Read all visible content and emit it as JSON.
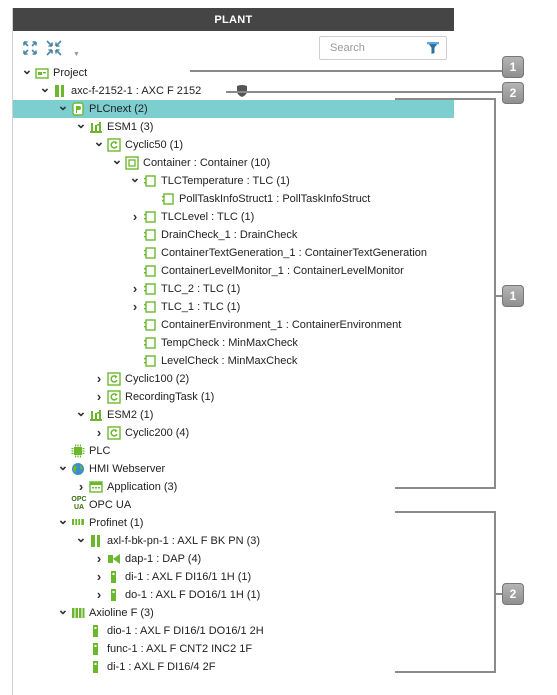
{
  "panel": {
    "title": "PLANT",
    "toolbar": {
      "expand_all_icon": "expand-all-icon",
      "collapse_all_icon": "collapse-all-icon",
      "search_placeholder": "Search",
      "filter_icon": "filter-icon"
    }
  },
  "tree": [
    {
      "id": "project",
      "label": "Project",
      "expander": "expanded",
      "icon": "project-icon"
    },
    {
      "id": "controller",
      "label": "axc-f-2152-1 : AXC F 2152",
      "expander": "expanded",
      "icon": "controller-icon",
      "shield_icon": "shield-icon"
    },
    {
      "id": "plcnext",
      "label": "PLCnext (2)",
      "expander": "expanded",
      "icon": "plcnext-icon",
      "selected": true
    },
    {
      "id": "esm1",
      "label": "ESM1 (3)",
      "expander": "expanded",
      "icon": "esm-icon"
    },
    {
      "id": "cyclic50",
      "label": "Cyclic50 (1)",
      "expander": "expanded",
      "icon": "task-icon"
    },
    {
      "id": "container",
      "label": "Container : Container (10)",
      "expander": "expanded",
      "icon": "container-icon"
    },
    {
      "id": "tlctemperature",
      "label": "TLCTemperature : TLC (1)",
      "expander": "expanded",
      "icon": "program-icon"
    },
    {
      "id": "polltask",
      "label": "PollTaskInfoStruct1 : PollTaskInfoStruct",
      "expander": "none",
      "icon": "program-icon"
    },
    {
      "id": "tlclevel",
      "label": "TLCLevel : TLC (1)",
      "expander": "collapsed",
      "icon": "program-icon"
    },
    {
      "id": "draincheck",
      "label": "DrainCheck_1 : DrainCheck",
      "expander": "none",
      "icon": "program-icon"
    },
    {
      "id": "containertextgeneration",
      "label": "ContainerTextGeneration_1 : ContainerTextGeneration",
      "expander": "none",
      "icon": "program-icon"
    },
    {
      "id": "containerlevelmonitor",
      "label": "ContainerLevelMonitor_1 : ContainerLevelMonitor",
      "expander": "none",
      "icon": "program-icon"
    },
    {
      "id": "tlc2",
      "label": "TLC_2 : TLC (1)",
      "expander": "collapsed",
      "icon": "program-icon"
    },
    {
      "id": "tlc1",
      "label": "TLC_1 : TLC (1)",
      "expander": "collapsed",
      "icon": "program-icon"
    },
    {
      "id": "containerenvironment",
      "label": "ContainerEnvironment_1 : ContainerEnvironment",
      "expander": "none",
      "icon": "program-icon"
    },
    {
      "id": "tempcheck",
      "label": "TempCheck : MinMaxCheck",
      "expander": "none",
      "icon": "program-icon"
    },
    {
      "id": "levelcheck",
      "label": "LevelCheck : MinMaxCheck",
      "expander": "none",
      "icon": "program-icon"
    },
    {
      "id": "cyclic100",
      "label": "Cyclic100 (2)",
      "expander": "collapsed",
      "icon": "task-icon"
    },
    {
      "id": "recordingtask",
      "label": "RecordingTask (1)",
      "expander": "collapsed",
      "icon": "task-icon"
    },
    {
      "id": "esm2",
      "label": "ESM2 (1)",
      "expander": "expanded",
      "icon": "esm-icon"
    },
    {
      "id": "cyclic200",
      "label": "Cyclic200 (4)",
      "expander": "collapsed",
      "icon": "task-icon"
    },
    {
      "id": "plc",
      "label": "PLC",
      "expander": "none",
      "icon": "plc-icon"
    },
    {
      "id": "hmiwebserver",
      "label": "HMI Webserver",
      "expander": "expanded",
      "icon": "globe-icon"
    },
    {
      "id": "application",
      "label": "Application (3)",
      "expander": "collapsed",
      "icon": "application-icon"
    },
    {
      "id": "opcua",
      "label": "OPC UA",
      "expander": "none",
      "icon": "opc-ua-icon",
      "icon_text": "OPC UA"
    },
    {
      "id": "profinet",
      "label": "Profinet (1)",
      "expander": "expanded",
      "icon": "profinet-icon"
    },
    {
      "id": "axlbkpn",
      "label": "axl-f-bk-pn-1 : AXL F BK PN (3)",
      "expander": "expanded",
      "icon": "bus-coupler-icon"
    },
    {
      "id": "dap1",
      "label": "dap-1 : DAP (4)",
      "expander": "collapsed",
      "icon": "dap-icon"
    },
    {
      "id": "di1",
      "label": "di-1 : AXL F DI16/1 1H (1)",
      "expander": "collapsed",
      "icon": "io-module-icon"
    },
    {
      "id": "do1",
      "label": "do-1 : AXL F DO16/1 1H (1)",
      "expander": "collapsed",
      "icon": "io-module-icon"
    },
    {
      "id": "axioline",
      "label": "Axioline F (3)",
      "expander": "expanded",
      "icon": "axioline-icon"
    },
    {
      "id": "dio1",
      "label": "dio-1 : AXL F DI16/1 DO16/1 2H",
      "expander": "none",
      "icon": "io-module-icon"
    },
    {
      "id": "func1",
      "label": "func-1 : AXL F CNT2 INC2 1F",
      "expander": "none",
      "icon": "io-module-icon"
    },
    {
      "id": "di1axl",
      "label": "di-1 : AXL F DI16/4 2F",
      "expander": "none",
      "icon": "io-module-icon"
    }
  ],
  "callouts": [
    "1",
    "2",
    "1",
    "2"
  ],
  "colors": {
    "header_bg": "#454545",
    "selection": "#7dcece",
    "icon_green": "#6bb82d",
    "callout_gray": "#9a9a9a"
  }
}
